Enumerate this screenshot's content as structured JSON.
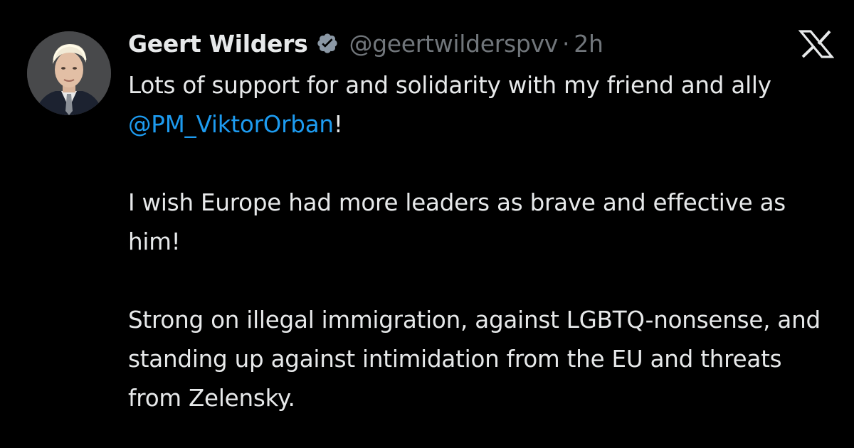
{
  "author": {
    "display_name": "Geert Wilders",
    "handle": "@geertwilderspvv",
    "separator": "·",
    "time": "2h",
    "verified_badge_color": "#8b98a5"
  },
  "tweet": {
    "p1_text": "Lots of support for and solidarity with my friend and ally ",
    "p1_mention": "@PM_ViktorOrban",
    "p1_suffix": "!",
    "p2": "I wish Europe had more leaders as brave and effective as him!",
    "p3": "Strong on illegal immigration, against LGBTQ-nonsense, and standing up against intimidation from the EU and threats from Zelensky."
  },
  "icons": {
    "avatar": "profile-photo",
    "verified": "verified-badge-icon",
    "brand": "x-logo-icon"
  },
  "colors": {
    "background": "#000000",
    "text": "#e7e9ea",
    "muted": "#71767b",
    "link": "#1d9bf0"
  }
}
